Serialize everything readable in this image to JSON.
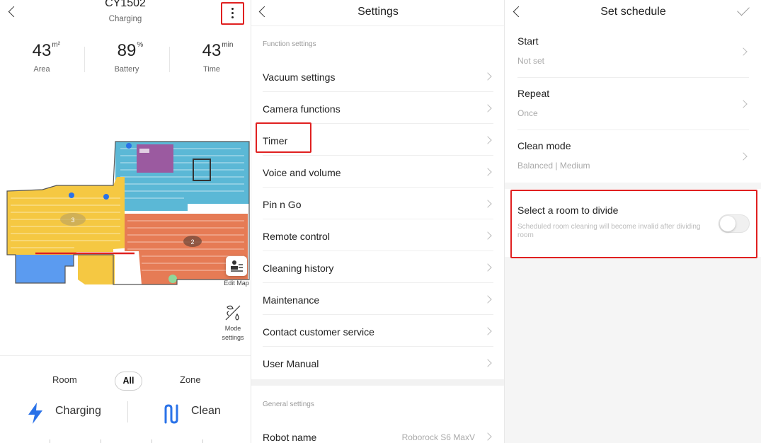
{
  "home": {
    "title": "CY1502",
    "status": "Charging",
    "stats": [
      {
        "value": "43",
        "unit": "m²",
        "label": "Area"
      },
      {
        "value": "89",
        "unit": "%",
        "label": "Battery"
      },
      {
        "value": "43",
        "unit": "min",
        "label": "Time"
      }
    ],
    "map": {
      "room_labels": [
        "3",
        "2"
      ]
    },
    "edit_map_label": "Edit Map",
    "mode_settings_label": "Mode settings",
    "tabs": [
      "Room",
      "All",
      "Zone"
    ],
    "selected_tab": "All",
    "charging_label": "Charging",
    "clean_label": "Clean",
    "colors": {
      "accent": "#2a72e8",
      "yellow_room": "#f5c842",
      "blue_room": "#5bb8d6",
      "orange_room": "#e67b55",
      "purple_area": "#9b5aa0",
      "highlight": "#e02020"
    }
  },
  "settings": {
    "title": "Settings",
    "function_section": "Function settings",
    "items": [
      "Vacuum settings",
      "Camera functions",
      "Timer",
      "Voice and volume",
      "Pin n Go",
      "Remote control",
      "Cleaning history",
      "Maintenance",
      "Contact customer service",
      "User Manual"
    ],
    "general_section": "General settings",
    "robot_name_label": "Robot name",
    "robot_name_value": "Roborock S6 MaxV"
  },
  "schedule": {
    "title": "Set schedule",
    "start_label": "Start",
    "start_value": "Not set",
    "repeat_label": "Repeat",
    "repeat_value": "Once",
    "clean_mode_label": "Clean mode",
    "clean_mode_value": "Balanced | Medium",
    "divide_label": "Select a room to divide",
    "divide_note": "Scheduled room cleaning will become invalid after dividing room",
    "divide_enabled": false
  }
}
